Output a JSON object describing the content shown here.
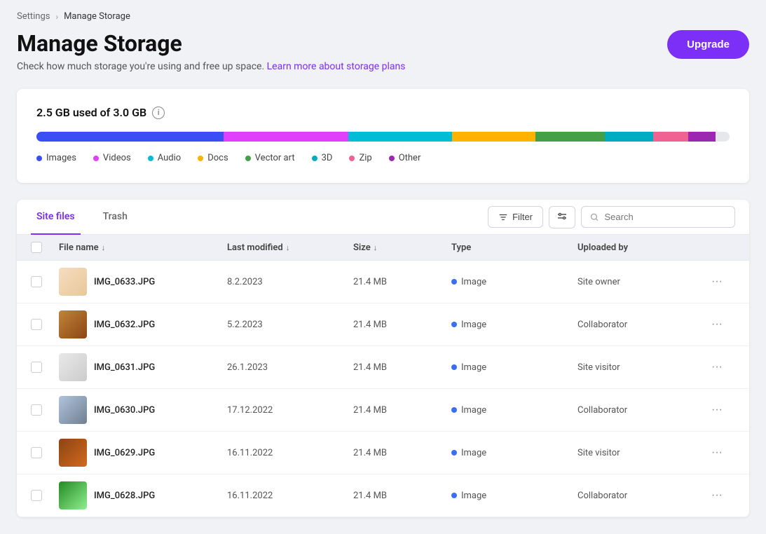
{
  "breadcrumb": {
    "parent": "Settings",
    "separator": "›",
    "current": "Manage Storage"
  },
  "header": {
    "title": "Manage Storage",
    "subtitle": "Check how much storage you're using and free up space.",
    "learn_more_link": "Learn more about storage plans",
    "upgrade_btn": "Upgrade"
  },
  "storage": {
    "used_label": "2.5 GB used of 3.0 GB",
    "info_icon": "ℹ",
    "bar_segments": [
      {
        "id": "images",
        "color": "#3b4ef5",
        "width": "27%"
      },
      {
        "id": "videos",
        "color": "#e040fb",
        "width": "18%"
      },
      {
        "id": "audio",
        "color": "#00bcd4",
        "width": "15%"
      },
      {
        "id": "docs",
        "color": "#ffb300",
        "width": "12%"
      },
      {
        "id": "vector_art",
        "color": "#43a047",
        "width": "10%"
      },
      {
        "id": "3d",
        "color": "#00acc1",
        "width": "7%"
      },
      {
        "id": "zip",
        "color": "#f06292",
        "width": "5%"
      },
      {
        "id": "other",
        "color": "#9c27b0",
        "width": "4%"
      }
    ],
    "legend": [
      {
        "label": "Images",
        "color": "#3b4ef5"
      },
      {
        "label": "Videos",
        "color": "#e040fb"
      },
      {
        "label": "Audio",
        "color": "#00bcd4"
      },
      {
        "label": "Docs",
        "color": "#ffb300"
      },
      {
        "label": "Vector art",
        "color": "#43a047"
      },
      {
        "label": "3D",
        "color": "#00acc1"
      },
      {
        "label": "Zip",
        "color": "#f06292"
      },
      {
        "label": "Other",
        "color": "#9c27b0"
      }
    ]
  },
  "tabs": [
    {
      "id": "site-files",
      "label": "Site files",
      "active": true
    },
    {
      "id": "trash",
      "label": "Trash",
      "active": false
    }
  ],
  "toolbar": {
    "filter_btn": "Filter",
    "search_placeholder": "Search"
  },
  "table": {
    "columns": [
      {
        "id": "filename",
        "label": "File name",
        "sortable": true
      },
      {
        "id": "modified",
        "label": "Last modified",
        "sortable": true
      },
      {
        "id": "size",
        "label": "Size",
        "sortable": true
      },
      {
        "id": "type",
        "label": "Type",
        "sortable": false
      },
      {
        "id": "uploaded_by",
        "label": "Uploaded by",
        "sortable": false
      }
    ],
    "rows": [
      {
        "id": 1,
        "name": "IMG_0633.JPG",
        "modified": "8.2.2023",
        "size": "21.4 MB",
        "type": "Image",
        "uploader": "Site owner",
        "thumb_class": "thumb-1"
      },
      {
        "id": 2,
        "name": "IMG_0632.JPG",
        "modified": "5.2.2023",
        "size": "21.4 MB",
        "type": "Image",
        "uploader": "Collaborator",
        "thumb_class": "thumb-2"
      },
      {
        "id": 3,
        "name": "IMG_0631.JPG",
        "modified": "26.1.2023",
        "size": "21.4 MB",
        "type": "Image",
        "uploader": "Site visitor",
        "thumb_class": "thumb-3"
      },
      {
        "id": 4,
        "name": "IMG_0630.JPG",
        "modified": "17.12.2022",
        "size": "21.4 MB",
        "type": "Image",
        "uploader": "Collaborator",
        "thumb_class": "thumb-4"
      },
      {
        "id": 5,
        "name": "IMG_0629.JPG",
        "modified": "16.11.2022",
        "size": "21.4 MB",
        "type": "Image",
        "uploader": "Site visitor",
        "thumb_class": "thumb-5"
      },
      {
        "id": 6,
        "name": "IMG_0628.JPG",
        "modified": "16.11.2022",
        "size": "21.4 MB",
        "type": "Image",
        "uploader": "Collaborator",
        "thumb_class": "thumb-6"
      }
    ]
  },
  "icons": {
    "sort_arrow": "↓",
    "filter": "⊟",
    "search": "🔍",
    "more": "···"
  }
}
